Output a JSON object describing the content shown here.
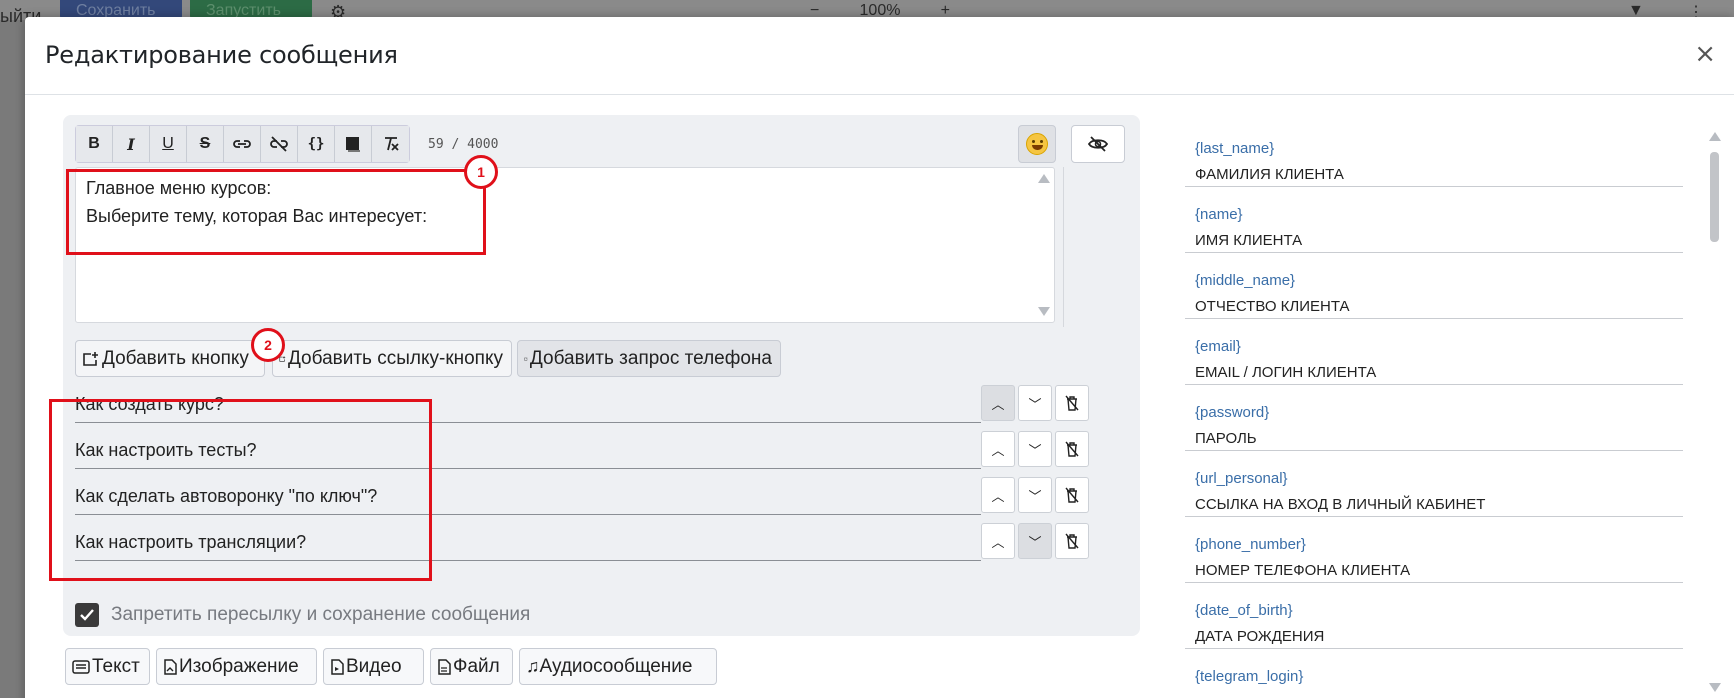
{
  "background": {
    "left_text": "ыйти",
    "save_label": "Сохранить",
    "launch_label": "Запустить",
    "zoom_minus": "−",
    "zoom_value": "100%",
    "zoom_plus": "+"
  },
  "modal": {
    "title": "Редактирование сообщения",
    "close": "×"
  },
  "toolbar": {
    "bold": "B",
    "italic": "I",
    "underline": "U",
    "strike": "S",
    "code": "{}",
    "counter": "59 / 4000"
  },
  "message": {
    "line1": "Главное меню курсов:",
    "line2": "Выберите тему, которая Вас интересует:"
  },
  "annotations": {
    "marker1": "1",
    "marker2": "2"
  },
  "add_buttons": {
    "add_button": "Добавить кнопку",
    "add_link_button": "Добавить ссылку-кнопку",
    "add_phone_request": "Добавить запрос телефона"
  },
  "buttons_list": [
    {
      "label": "Как создать курс?"
    },
    {
      "label": "Как настроить тесты?"
    },
    {
      "label": "Как сделать автоворонку \"по ключ\"?"
    },
    {
      "label": "Как настроить трансляции?"
    }
  ],
  "forbid_forward": {
    "label": "Запретить пересылку и сохранение сообщения",
    "checked": true
  },
  "type_tabs": {
    "text": "Текст",
    "image": "Изображение",
    "video": "Видео",
    "file": "Файл",
    "audio": "Аудиосообщение"
  },
  "variables": [
    {
      "key": "{last_name}",
      "desc": "ФАМИЛИЯ КЛИЕНТА"
    },
    {
      "key": "{name}",
      "desc": "ИМЯ КЛИЕНТА"
    },
    {
      "key": "{middle_name}",
      "desc": "ОТЧЕСТВО КЛИЕНТА"
    },
    {
      "key": "{email}",
      "desc": "EMAIL / ЛОГИН КЛИЕНТА"
    },
    {
      "key": "{password}",
      "desc": "ПАРОЛЬ"
    },
    {
      "key": "{url_personal}",
      "desc": "ССЫЛКА НА ВХОД В ЛИЧНЫЙ КАБИНЕТ"
    },
    {
      "key": "{phone_number}",
      "desc": "НОМЕР ТЕЛЕФОНА КЛИЕНТА"
    },
    {
      "key": "{date_of_birth}",
      "desc": "ДАТА РОЖДЕНИЯ"
    },
    {
      "key": "{telegram_login}",
      "desc": ""
    }
  ],
  "colors": {
    "annotation": "#e0101a",
    "variable_key": "#3a6ea8"
  }
}
